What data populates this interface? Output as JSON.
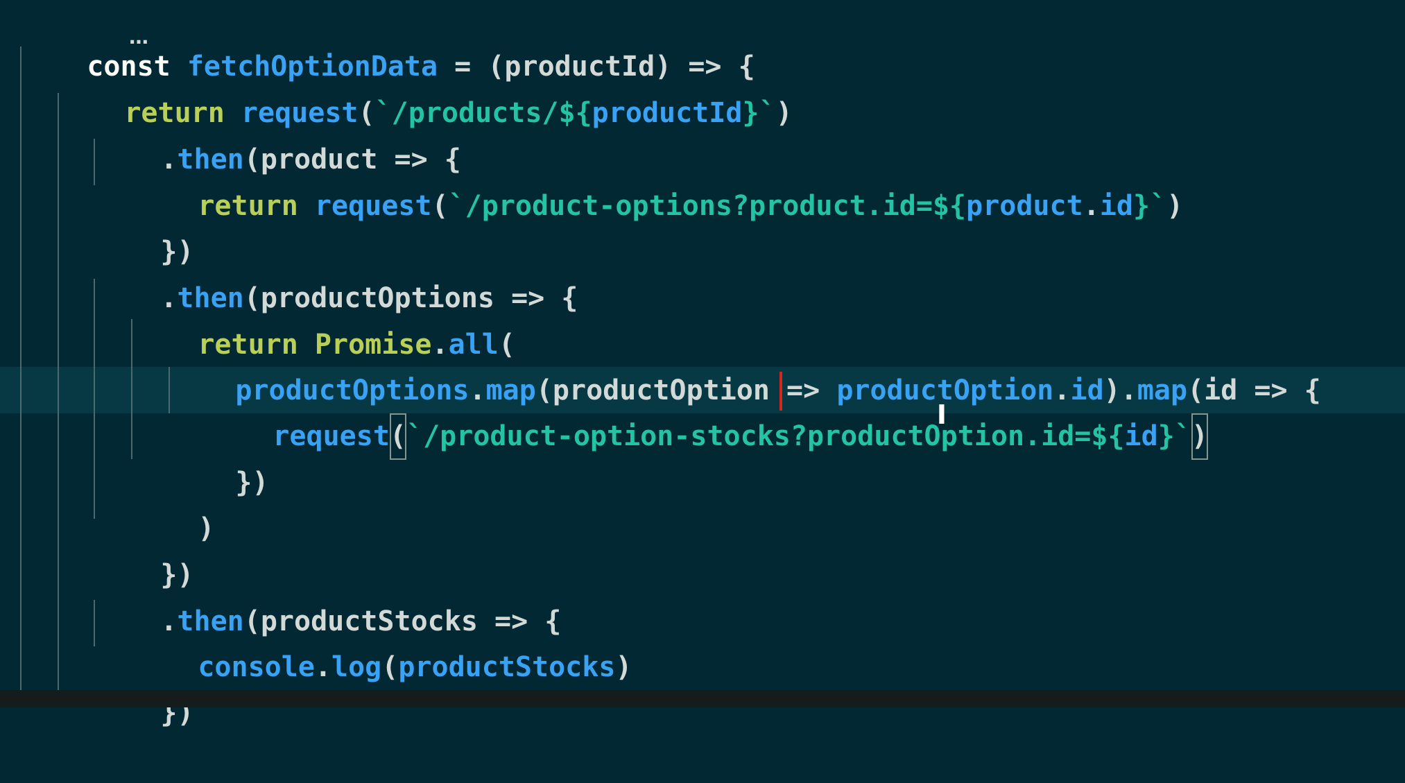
{
  "editor": {
    "lines": [
      [
        "const",
        " ",
        "fetchOptionData",
        " = (",
        "productId",
        ") => {"
      ],
      [
        "return",
        " ",
        "request",
        "(",
        "`/products/${",
        "productId",
        "}`",
        ")"
      ],
      [
        ".",
        "then",
        "(product => {"
      ],
      [
        "return",
        " ",
        "request",
        "(",
        "`/product-options?product.id=${",
        "product",
        ".",
        "id",
        "}`",
        ")"
      ],
      [
        "})"
      ],
      [
        ".",
        "then",
        "(productOptions => {"
      ],
      [
        "return",
        " ",
        "Promise",
        ".",
        "all",
        "("
      ],
      [
        "productOptions",
        ".",
        "map",
        "(productOption => ",
        "productOption",
        ".",
        "id",
        ").",
        "map",
        "(id => {"
      ],
      [
        "request",
        "(",
        "`/product-option-stocks",
        "?productOption.id=${",
        "id",
        "}`",
        ")"
      ],
      [
        "})"
      ],
      [
        ")"
      ],
      [
        "})"
      ],
      [
        ".",
        "then",
        "(productStocks => {"
      ],
      [
        "console",
        ".",
        "log",
        "(",
        "productStocks",
        ")"
      ],
      [
        "})"
      ]
    ],
    "cursor_mouse_glyph": "I",
    "fold_marker": "…"
  },
  "status_bar": {
    "text": ""
  },
  "colors": {
    "background": "#022833",
    "active_line": "#073944",
    "keyword": "#fbfbf7",
    "return_keyword": "#b9cf58",
    "function": "#3aa2f4",
    "string": "#25c3a5",
    "text": "#d3d9d6",
    "cursor": "#d2271f"
  }
}
